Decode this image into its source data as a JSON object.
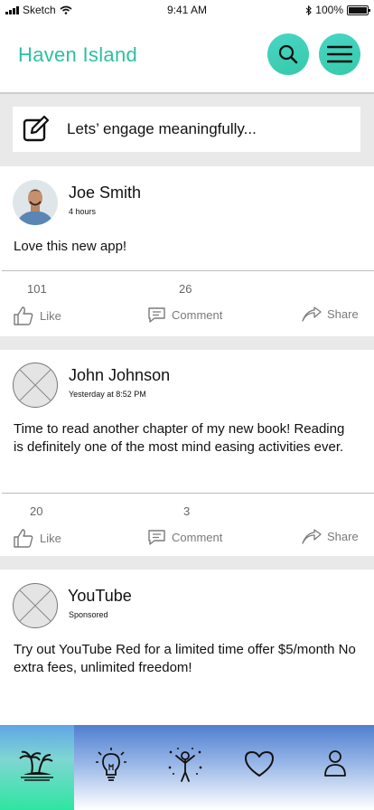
{
  "status_bar": {
    "carrier": "Sketch",
    "time": "9:41 AM",
    "battery": "100%"
  },
  "header": {
    "logo_text": "Haven Island"
  },
  "composer": {
    "placeholder": "Lets’ engage meaningfully..."
  },
  "posts": [
    {
      "name": "Joe Smith",
      "time": "4 hours",
      "body": "Love this new app!",
      "likes": "101",
      "comments": "26",
      "like_label": "Like",
      "comment_label": "Comment",
      "share_label": "Share"
    },
    {
      "name": "John Johnson",
      "time": "Yesterday at 8:52 PM",
      "body": "Time to read another chapter of my new book! Reading is definitely one of the most mind easing activities ever.",
      "likes": "20",
      "comments": "3",
      "like_label": "Like",
      "comment_label": "Comment",
      "share_label": "Share"
    },
    {
      "name": "YouTube",
      "time": "Sponsored",
      "body": "Try out YouTube Red for a limited time offer $5/month No extra fees, unlimited freedom!"
    }
  ],
  "bottom_nav": {
    "items": [
      "island-icon",
      "lightbulb-icon",
      "celebrate-icon",
      "heart-icon",
      "profile-icon"
    ],
    "active": "island-icon"
  },
  "colors": {
    "brand": "#2cc0a4",
    "button": "#3ccfb4",
    "nav_top": "#4f7fd0",
    "nav_active": "#2ee6a2"
  }
}
